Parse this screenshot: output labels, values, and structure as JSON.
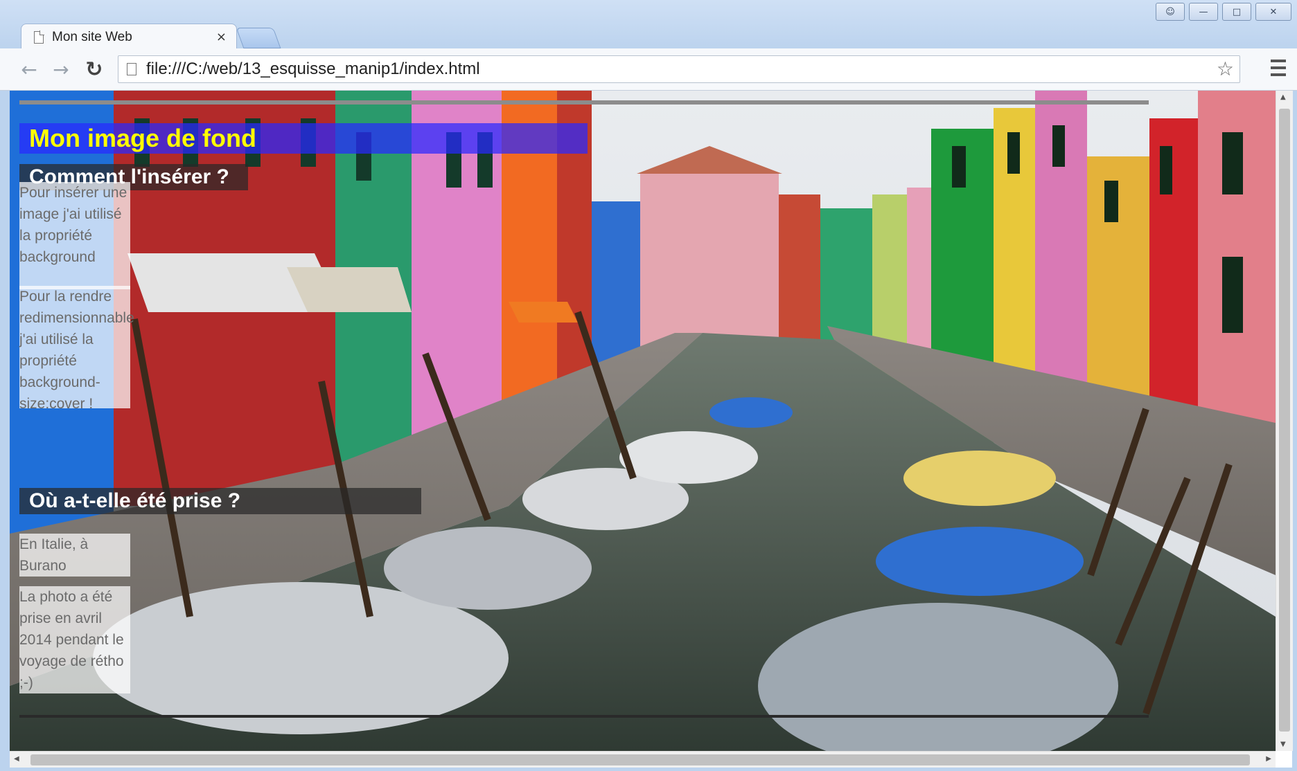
{
  "browser": {
    "tab_title": "Mon site Web",
    "url": "file:///C:/web/13_esquisse_manip1/index.html",
    "window_controls": [
      "user-icon",
      "minimize-icon",
      "restore-icon",
      "close-icon"
    ]
  },
  "page": {
    "title": "Mon image de fond",
    "sections": [
      {
        "heading": "Comment l'insérer ?",
        "paragraphs": [
          "Pour insérer une image j'ai utilisé la propriété background",
          "Pour la rendre redimensionnable j'ai utilisé la propriété background-size:cover !"
        ]
      },
      {
        "heading": "Où a-t-elle été prise ?",
        "paragraphs": [
          "En Italie, à Burano",
          "La photo a été prise en avril 2014 pendant le voyage de rétho ;-)"
        ]
      }
    ],
    "background_photo": "Colorful houses along a canal with moored boats (Burano)",
    "colors": {
      "title_bg": "#2828ff",
      "title_text": "#ffff00",
      "heading_bg": "#282828",
      "heading_text": "#ffffff",
      "note_bg": "#ffffff",
      "note_text": "#6b6b6b"
    }
  }
}
